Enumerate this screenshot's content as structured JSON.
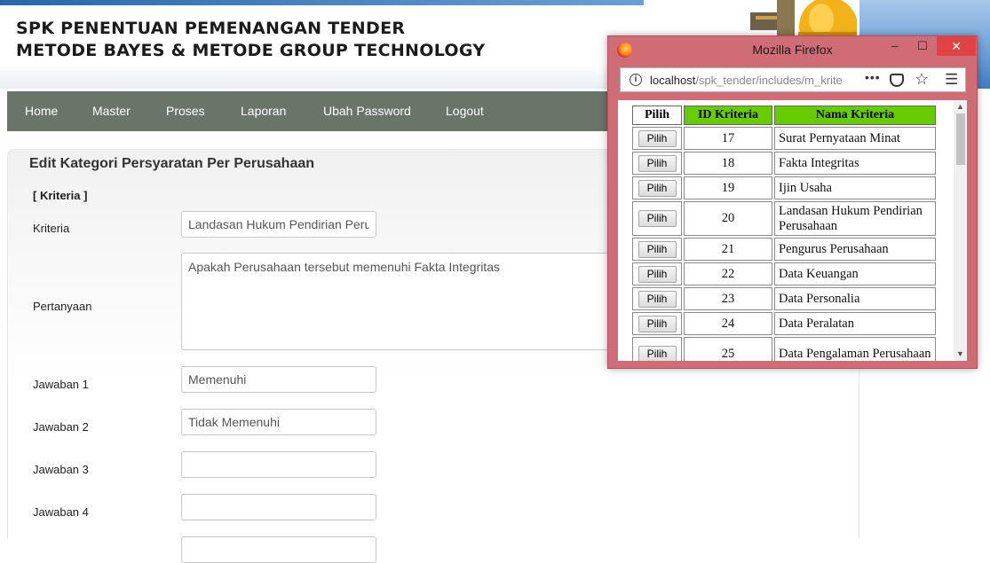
{
  "header": {
    "title_line1": "SPK PENENTUAN PEMENANGAN TENDER",
    "title_line2": "METODE BAYES & METODE GROUP TECHNOLOGY"
  },
  "nav": {
    "items": [
      "Home",
      "Master",
      "Proses",
      "Laporan",
      "Ubah Password",
      "Logout"
    ]
  },
  "form": {
    "title": "Edit Kategori Persyaratan Per Perusahaan",
    "section": "[ Kriteria ]",
    "fields": {
      "kriteria": {
        "label": "Kriteria",
        "value": "Landasan Hukum Pendirian Perusahaan"
      },
      "pertanyaan": {
        "label": "Pertanyaan",
        "value": "Apakah Perusahaan tersebut memenuhi Fakta Integritas"
      },
      "jawaban1": {
        "label": "Jawaban 1",
        "value": "Memenuhi"
      },
      "jawaban2": {
        "label": "Jawaban 2",
        "value": "Tidak Memenuhi"
      },
      "jawaban3": {
        "label": "Jawaban 3",
        "value": ""
      },
      "jawaban4": {
        "label": "Jawaban 4",
        "value": ""
      }
    }
  },
  "popup": {
    "window_title": "Mozilla Firefox",
    "controls": {
      "minimize": "–",
      "maximize": "☐",
      "close": "✕"
    },
    "url_host": "localhost",
    "url_path": "/spk_tender/includes/m_krite",
    "url_more": "•••",
    "table": {
      "headers": [
        "Pilih",
        "ID Kriteria",
        "Nama Kriteria"
      ],
      "button_label": "Pilih",
      "rows": [
        {
          "id": "17",
          "nama": "Surat Pernyataan Minat"
        },
        {
          "id": "18",
          "nama": "Fakta Integritas"
        },
        {
          "id": "19",
          "nama": "Ijin Usaha"
        },
        {
          "id": "20",
          "nama": "Landasan Hukum Pendirian Perusahaan"
        },
        {
          "id": "21",
          "nama": "Pengurus Perusahaan"
        },
        {
          "id": "22",
          "nama": "Data Keuangan"
        },
        {
          "id": "23",
          "nama": "Data Personalia"
        },
        {
          "id": "24",
          "nama": "Data Peralatan"
        },
        {
          "id": "25",
          "nama": "Data Pengalaman Perusahaan"
        }
      ]
    }
  },
  "colors": {
    "nav_bg": "#6a7569",
    "table_header_green": "#66cc00",
    "popup_frame": "#d06c75",
    "close_button": "#e04343"
  },
  "icons": [
    "firefox-icon",
    "info-icon",
    "pocket-icon",
    "bookmark-star-icon",
    "hamburger-menu-icon",
    "helmet-icon"
  ]
}
